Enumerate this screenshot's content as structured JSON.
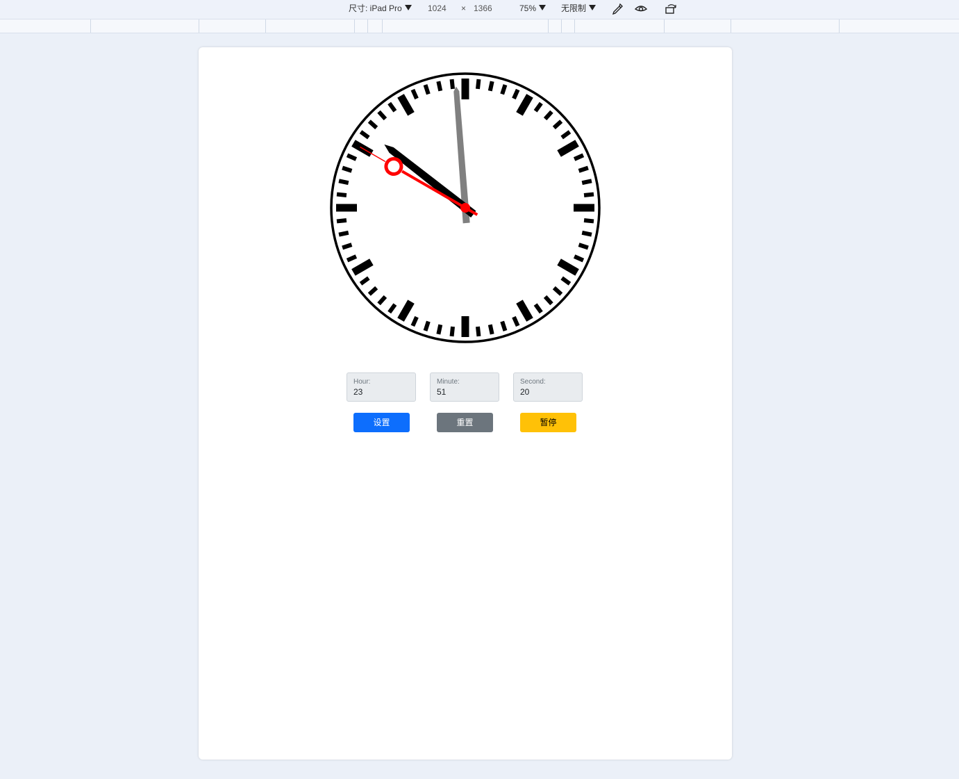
{
  "toolbar": {
    "size_label": "尺寸: iPad Pro",
    "width": "1024",
    "times": "×",
    "height": "1366",
    "zoom": "75%",
    "throttle": "无限制",
    "icons": [
      "eyedropper-icon",
      "eye-icon",
      "rotate-icon",
      "dropdown-triangle-icon"
    ]
  },
  "clock": {
    "hour": 23,
    "minute": 51,
    "second": 20,
    "hand_colors": {
      "hour": "#000000",
      "minute": "#808080",
      "second": "#ff0000"
    }
  },
  "form": {
    "hour_label": "Hour:",
    "hour_value": "23",
    "minute_label": "Minute:",
    "minute_value": "51",
    "second_label": "Second:",
    "second_value": "20"
  },
  "buttons": {
    "set_label": "设置",
    "reset_label": "重置",
    "pause_label": "暂停",
    "colors": {
      "set": "#0d6efd",
      "reset": "#6c757d",
      "pause": "#ffc107"
    }
  }
}
